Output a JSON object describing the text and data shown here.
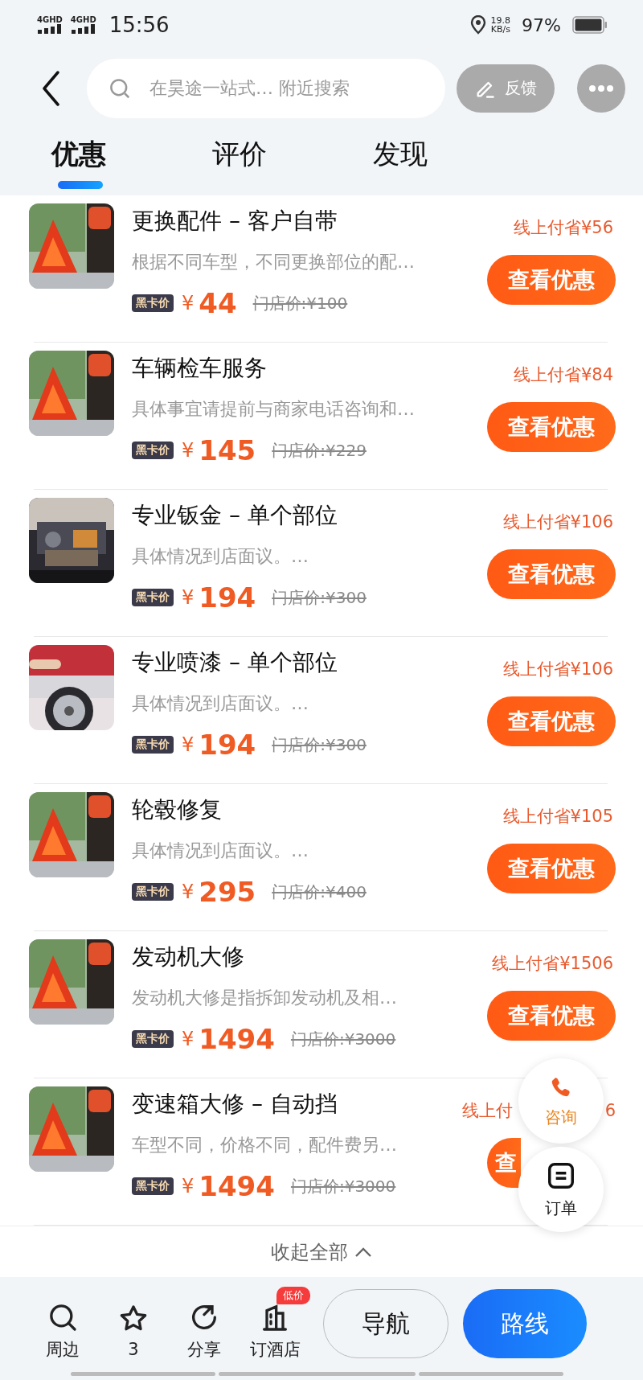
{
  "status_bar": {
    "network_1": "4GHD",
    "network_2": "4GHD",
    "time": "15:56",
    "speed_value": "19.8",
    "speed_unit": "KB/s",
    "battery": "97%"
  },
  "header": {
    "search": {
      "placeholder": "在昊途一站式… 附近搜索"
    },
    "feedback": "反馈"
  },
  "tabs": [
    {
      "label": "优惠",
      "selected": true
    },
    {
      "label": "评价",
      "selected": false
    },
    {
      "label": "发现",
      "selected": false
    }
  ],
  "deals": [
    {
      "kind": "picture",
      "title": "更换配件 – 客户自带",
      "description": "根据不同车型，不同更换部位的配…",
      "badge": "黑卡价",
      "currency": "¥",
      "price": "44",
      "store_price": "门店价:¥100",
      "saving": "线上付省¥56",
      "button": "查看优惠"
    },
    {
      "kind": "picture",
      "title": "车辆检车服务",
      "description": "具体事宜请提前与商家电话咨询和…",
      "badge": "黑卡价",
      "currency": "¥",
      "price": "145",
      "store_price": "门店价:¥229",
      "saving": "线上付省¥84",
      "button": "查看优惠"
    },
    {
      "kind": "picture",
      "title": "专业钣金 – 单个部位",
      "description": "具体情况到店面议。…",
      "badge": "黑卡价",
      "currency": "¥",
      "price": "194",
      "store_price": "门店价:¥300",
      "saving": "线上付省¥106",
      "button": "查看优惠"
    },
    {
      "kind": "picture",
      "title": "专业喷漆 – 单个部位",
      "description": "具体情况到店面议。…",
      "badge": "黑卡价",
      "currency": "¥",
      "price": "194",
      "store_price": "门店价:¥300",
      "saving": "线上付省¥106",
      "button": "查看优惠"
    },
    {
      "kind": "picture",
      "title": "轮毂修复",
      "description": "具体情况到店面议。…",
      "badge": "黑卡价",
      "currency": "¥",
      "price": "295",
      "store_price": "门店价:¥400",
      "saving": "线上付省¥105",
      "button": "查看优惠"
    },
    {
      "kind": "picture",
      "title": "发动机大修",
      "description": "发动机大修是指拆卸发动机及相…",
      "badge": "黑卡价",
      "currency": "¥",
      "price": "1494",
      "store_price": "门店价:¥3000",
      "saving": "线上付省¥1506",
      "button": "查看优惠"
    },
    {
      "kind": "picture",
      "title": "变速箱大修 – 自动挡",
      "description": "车型不同，价格不同，配件费另…",
      "badge": "黑卡价",
      "currency": "¥",
      "price": "1494",
      "store_price": "门店价:¥3000",
      "saving_parts": [
        "线上付",
        "6"
      ],
      "button": "查"
    }
  ],
  "collapse": "收起全部",
  "floating": {
    "consult": "咨询",
    "orders": "订单"
  },
  "bottom_bar": {
    "items": [
      {
        "kind": "search",
        "label": "周边"
      },
      {
        "kind": "star",
        "label": "3"
      },
      {
        "kind": "share",
        "label": "分享"
      },
      {
        "kind": "hotel",
        "label": "订酒店",
        "badge": "低价"
      }
    ],
    "navigate": "导航",
    "route": "路线"
  }
}
